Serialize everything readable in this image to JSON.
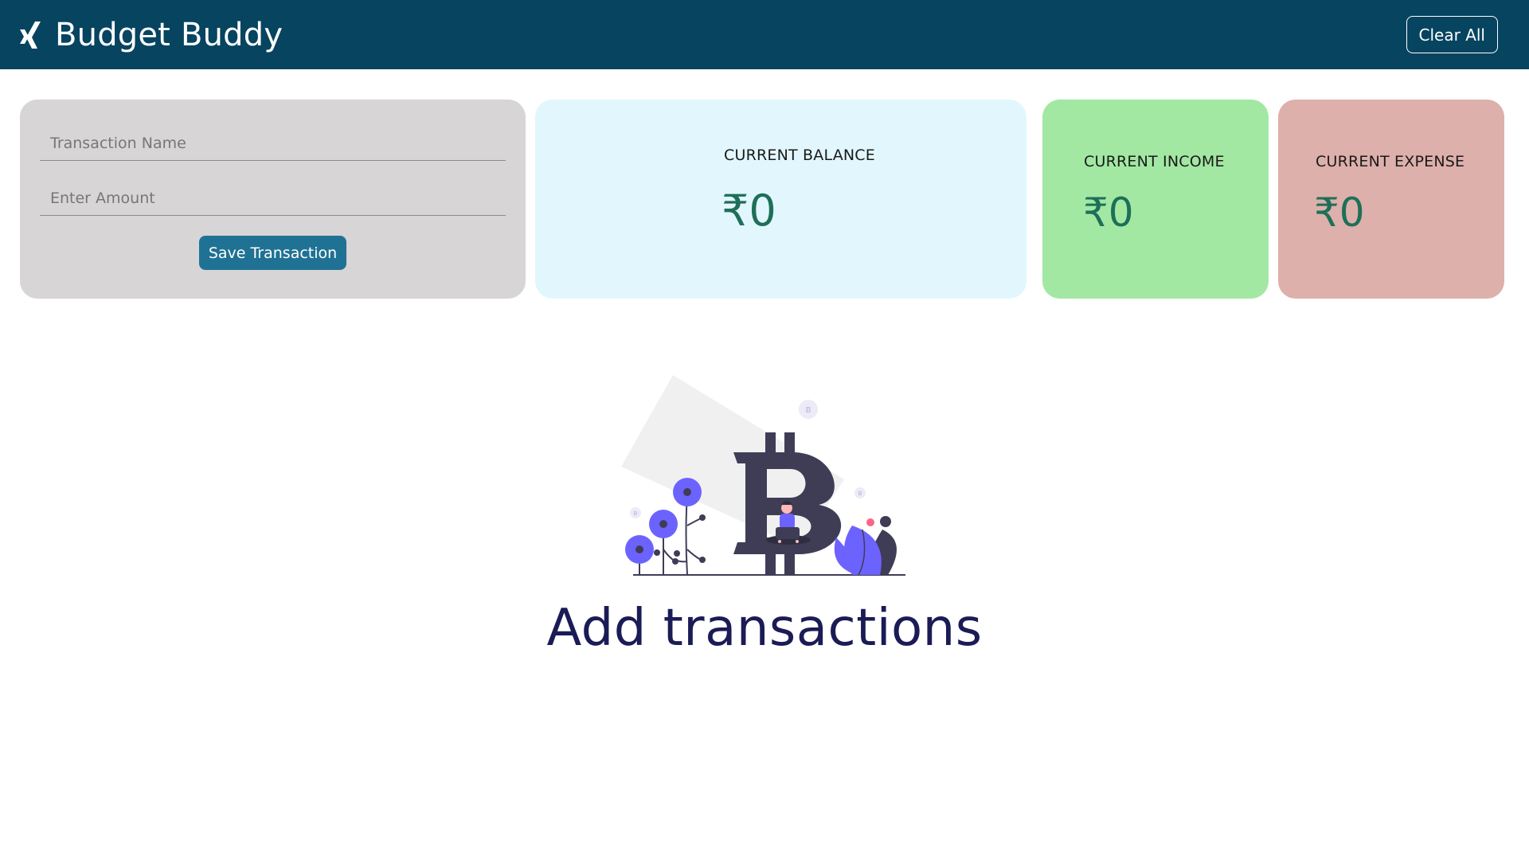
{
  "app": {
    "title": "Budget Buddy",
    "logo_icon": "xing-icon"
  },
  "header": {
    "clear_label": "Clear All"
  },
  "form": {
    "name_placeholder": "Transaction Name",
    "amount_placeholder": "Enter Amount",
    "save_label": "Save Transaction"
  },
  "stats": {
    "balance": {
      "label": "CURRENT BALANCE",
      "value": "₹0"
    },
    "income": {
      "label": "CURRENT INCOME",
      "value": "₹0"
    },
    "expense": {
      "label": "CURRENT EXPENSE",
      "value": "₹0"
    }
  },
  "empty_state": {
    "message": "Add transactions",
    "illustration_icon": "bitcoin-illustration"
  },
  "colors": {
    "navbar": "#064460",
    "form_card": "#d7d5d6",
    "balance_card": "#e2f7fd",
    "income_card": "#a2e8a3",
    "expense_card": "#ddb0ab",
    "save_button": "#1f7294",
    "value_text": "#1e6f58",
    "empty_text": "#1b1b56",
    "accent_purple": "#6c63ff"
  }
}
